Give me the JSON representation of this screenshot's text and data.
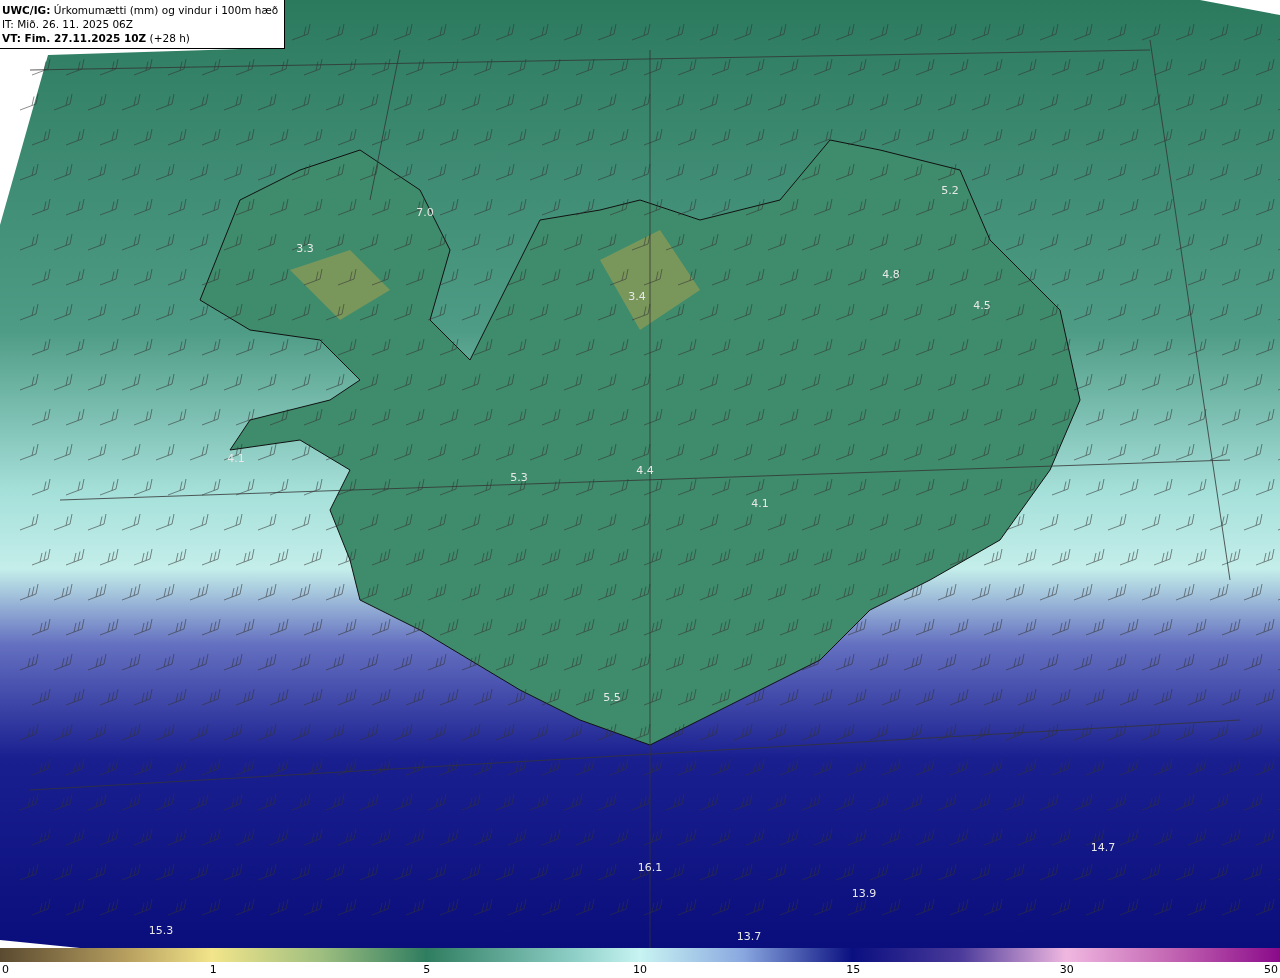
{
  "header": {
    "title": "**UWC/IG:** Úrkomumætti (mm) og vindur i 100m hæð",
    "init_time": "IT: Mið. 26. 11. 2025 06Z",
    "valid_time": "**VT: Fim. 27.11.2025 10Z** (+28 h)"
  },
  "map": {
    "values": [
      "7.0",
      "3.3",
      "3.4",
      "5.2",
      "4.8",
      "4.5",
      "4.1",
      "5.3",
      "4.4",
      "4.1",
      "5.5",
      "16.1",
      "14.7",
      "13.9",
      "15.3",
      "13.7"
    ]
  },
  "color_scale": {
    "ticks": [
      "0",
      "1",
      "5",
      "10",
      "15",
      "30",
      "50"
    ]
  }
}
